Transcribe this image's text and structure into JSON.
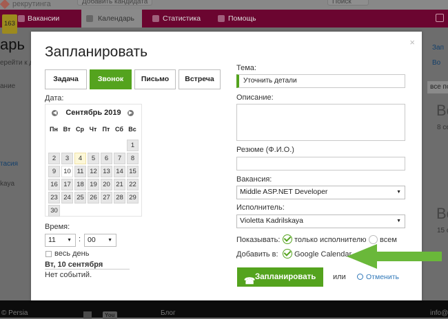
{
  "header": {
    "logo_text": "рекрутинга",
    "add_candidate_button": "Добавить кандидата",
    "search_text": "Поиск"
  },
  "nav": {
    "badge": "163",
    "items": [
      "Вакансии",
      "Календарь",
      "Статистика",
      "Помощь"
    ]
  },
  "background": {
    "page_title": "арь",
    "subtitle": "ерейти к да",
    "filter_text": "ание",
    "name1": "тасия",
    "name2": "kaya",
    "right_big_1": "Во",
    "right_sub_1": "8 се",
    "right_big_2": "Во",
    "right_sub_2": "15 с",
    "select_value": "все по",
    "right_link": "Зап",
    "right_text": "Во"
  },
  "footer": {
    "copyright": "© Persia",
    "blog": "Блог",
    "email": "info@l"
  },
  "modal": {
    "title": "Запланировать",
    "tabs": [
      "Задача",
      "Звонок",
      "Письмо",
      "Встреча"
    ],
    "active_tab": "Звонок",
    "date_label": "Дата:",
    "calendar": {
      "month": "Сентябрь 2019",
      "weekdays": [
        "Пн",
        "Вт",
        "Ср",
        "Чт",
        "Пт",
        "Сб",
        "Вс"
      ],
      "weeks": [
        [
          "",
          "",
          "",
          "",
          "",
          "",
          "1"
        ],
        [
          "2",
          "3",
          "4",
          "5",
          "6",
          "7",
          "8"
        ],
        [
          "9",
          "10",
          "11",
          "12",
          "13",
          "14",
          "15"
        ],
        [
          "16",
          "17",
          "18",
          "19",
          "20",
          "21",
          "22"
        ],
        [
          "23",
          "24",
          "25",
          "26",
          "27",
          "28",
          "29"
        ],
        [
          "30",
          "",
          "",
          "",
          "",
          "",
          ""
        ]
      ],
      "today": "4",
      "selected": "10"
    },
    "time_label": "Время:",
    "hour": "11",
    "time_sep": ":",
    "minute": "00",
    "all_day_label": "весь день",
    "selected_date": "Вт, 10 сентября",
    "no_events": "Нет событий.",
    "theme_label": "Тема:",
    "theme_value": "Уточнить детали",
    "description_label": "Описание:",
    "description_value": "",
    "resume_label": "Резюме (Ф.И.О.)",
    "resume_value": "",
    "vacancy_label": "Вакансия:",
    "vacancy_value": "Middle ASP.NET Developer",
    "executor_label": "Исполнитель:",
    "executor_value": "Violetta Kadrilskaya",
    "show_label": "Показывать:",
    "show_options": [
      "только исполнителю",
      "всем"
    ],
    "show_selected": "только исполнителю",
    "add_to_label": "Добавить в:",
    "add_to_value": "Google Calendar",
    "add_to_checked": true,
    "submit_label": "Запланировать",
    "or_text": "или",
    "cancel_label": "Отменить"
  },
  "colors": {
    "accent_green": "#54a31e",
    "nav_bg": "#6b0530",
    "link_blue": "#2e77b8",
    "arrow_green": "#6ab83a"
  }
}
